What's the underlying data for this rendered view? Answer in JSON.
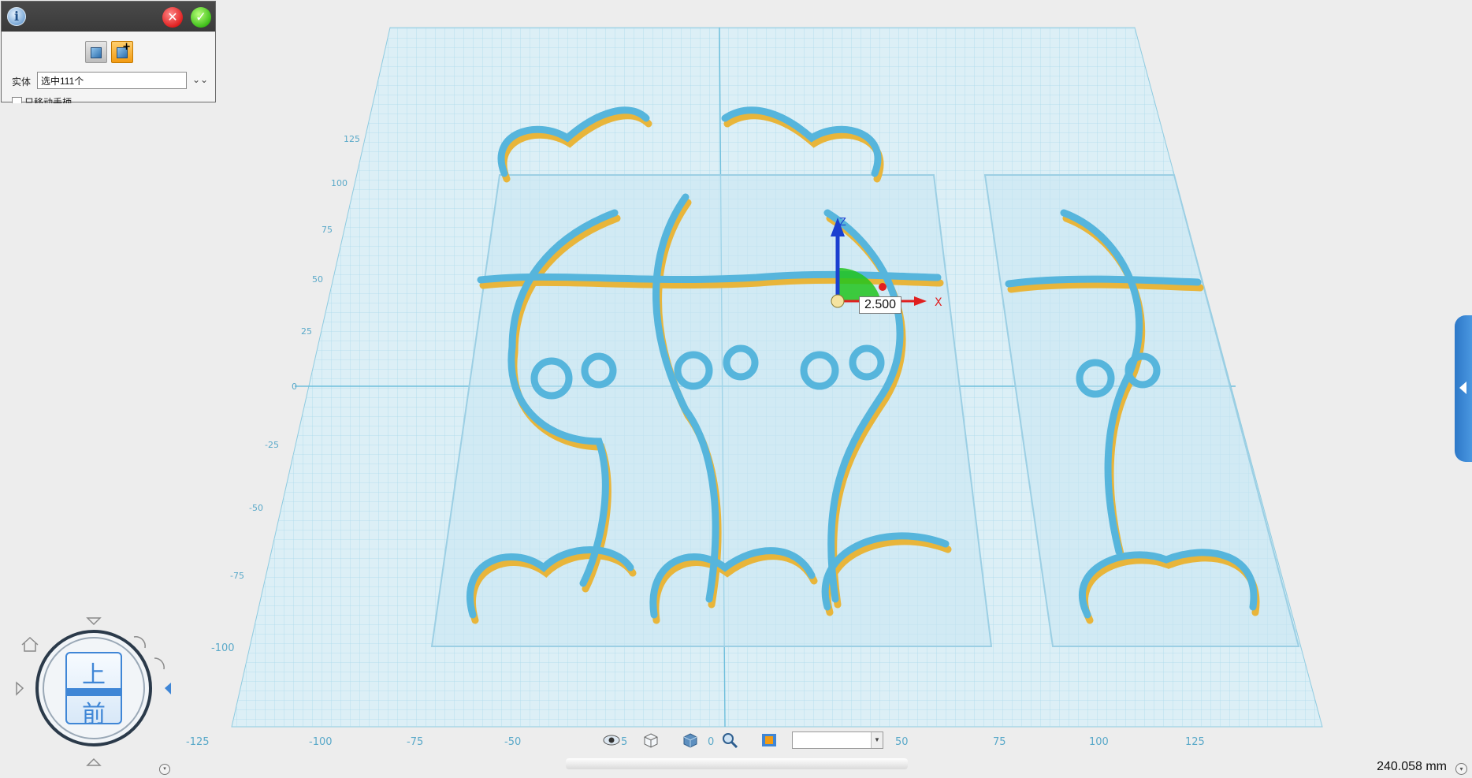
{
  "panel": {
    "entity_label": "实体",
    "entity_value": "选中111个",
    "checkbox_label": "只移动手柄"
  },
  "grid": {
    "x_ticks": [
      "-125",
      "-100",
      "-75",
      "-50",
      "50",
      "75",
      "100",
      "125"
    ],
    "y_ticks": [
      "125",
      "100",
      "75",
      "50",
      "25",
      "0",
      "-25",
      "-50",
      "-75",
      "-100"
    ],
    "x_tick_partial": "5",
    "x_tick_zero": "0"
  },
  "gizmo": {
    "dimension_value": "2.500",
    "axis_x": "X",
    "axis_z": "Z"
  },
  "viewcube": {
    "top_label": "上",
    "front_label": "前"
  },
  "status": {
    "measurement": "240.058 mm"
  },
  "colors": {
    "model_blue": "#56b5dc",
    "model_yellow": "#e8b53a",
    "grid_line": "#9fd3e6",
    "accent": "#3f86d6"
  }
}
